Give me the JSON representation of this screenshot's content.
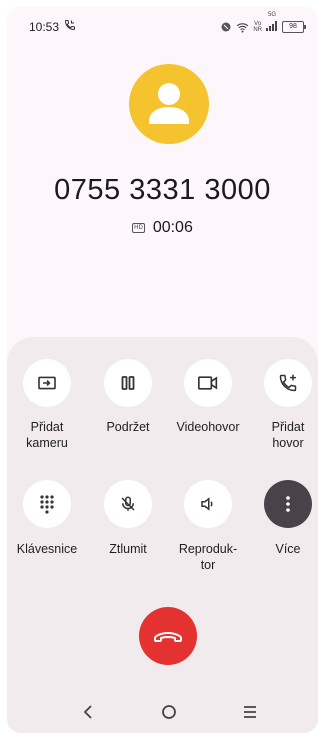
{
  "status_bar": {
    "time": "10:53",
    "volte_top": "Vo",
    "volte_bottom": "NR",
    "signal_tag": "5G",
    "battery": "98"
  },
  "call": {
    "number": "0755 3331 3000",
    "duration": "00:06",
    "hd_badge": "HD"
  },
  "actions": [
    {
      "label": "Přidat\nkameru",
      "icon": "add-camera-icon"
    },
    {
      "label": "Podržet",
      "icon": "pause-icon"
    },
    {
      "label": "Videohovor",
      "icon": "video-icon"
    },
    {
      "label": "Přidat\nhovor",
      "icon": "add-call-icon"
    },
    {
      "label": "Klávesnice",
      "icon": "dialpad-icon"
    },
    {
      "label": "Ztlumit",
      "icon": "mic-off-icon"
    },
    {
      "label": "Reproduk-\ntor",
      "icon": "speaker-icon"
    },
    {
      "label": "Více",
      "icon": "more-vertical-icon"
    }
  ],
  "colors": {
    "avatar_bg": "#f5c32e",
    "end_call": "#e3322f",
    "panel_bg": "#f1ebee"
  }
}
